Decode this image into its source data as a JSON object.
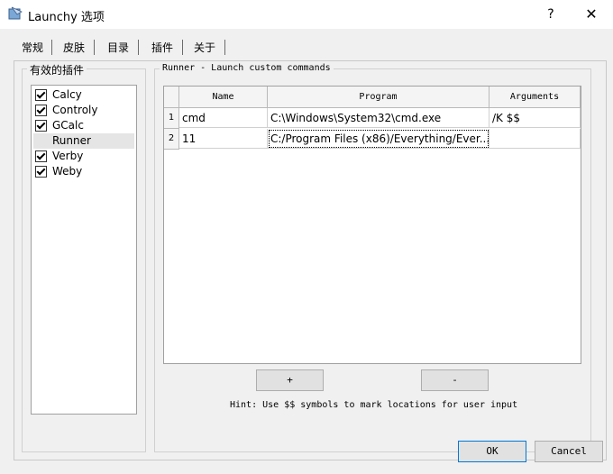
{
  "window": {
    "title": "Launchy 选项",
    "help_label": "?",
    "close_label": "✕",
    "icon": "launchy-app-icon"
  },
  "tabs": [
    {
      "label": "常规"
    },
    {
      "label": "皮肤"
    },
    {
      "label": "目录"
    },
    {
      "label": "插件",
      "selected": true
    },
    {
      "label": "关于"
    }
  ],
  "plugins": {
    "title": "有效的插件",
    "items": [
      {
        "label": "Calcy",
        "checked": true
      },
      {
        "label": "Controly",
        "checked": true
      },
      {
        "label": "GCalc",
        "checked": true
      },
      {
        "label": "Runner",
        "checked": false,
        "selected": true
      },
      {
        "label": "Verby",
        "checked": true
      },
      {
        "label": "Weby",
        "checked": true
      }
    ]
  },
  "runner": {
    "title": "Runner - Launch custom commands",
    "columns": [
      "Name",
      "Program",
      "Arguments"
    ],
    "rows": [
      {
        "index": "1",
        "name": "cmd",
        "program": "C:\\Windows\\System32\\cmd.exe",
        "arguments": "/K $$"
      },
      {
        "index": "2",
        "name": "11",
        "program": "C:/Program Files (x86)/Everything/Ever...",
        "arguments": ""
      }
    ],
    "add_label": "+",
    "remove_label": "-",
    "hint": "Hint: Use $$ symbols to mark locations for user input"
  },
  "footer": {
    "ok_label": "OK",
    "cancel_label": "Cancel"
  }
}
